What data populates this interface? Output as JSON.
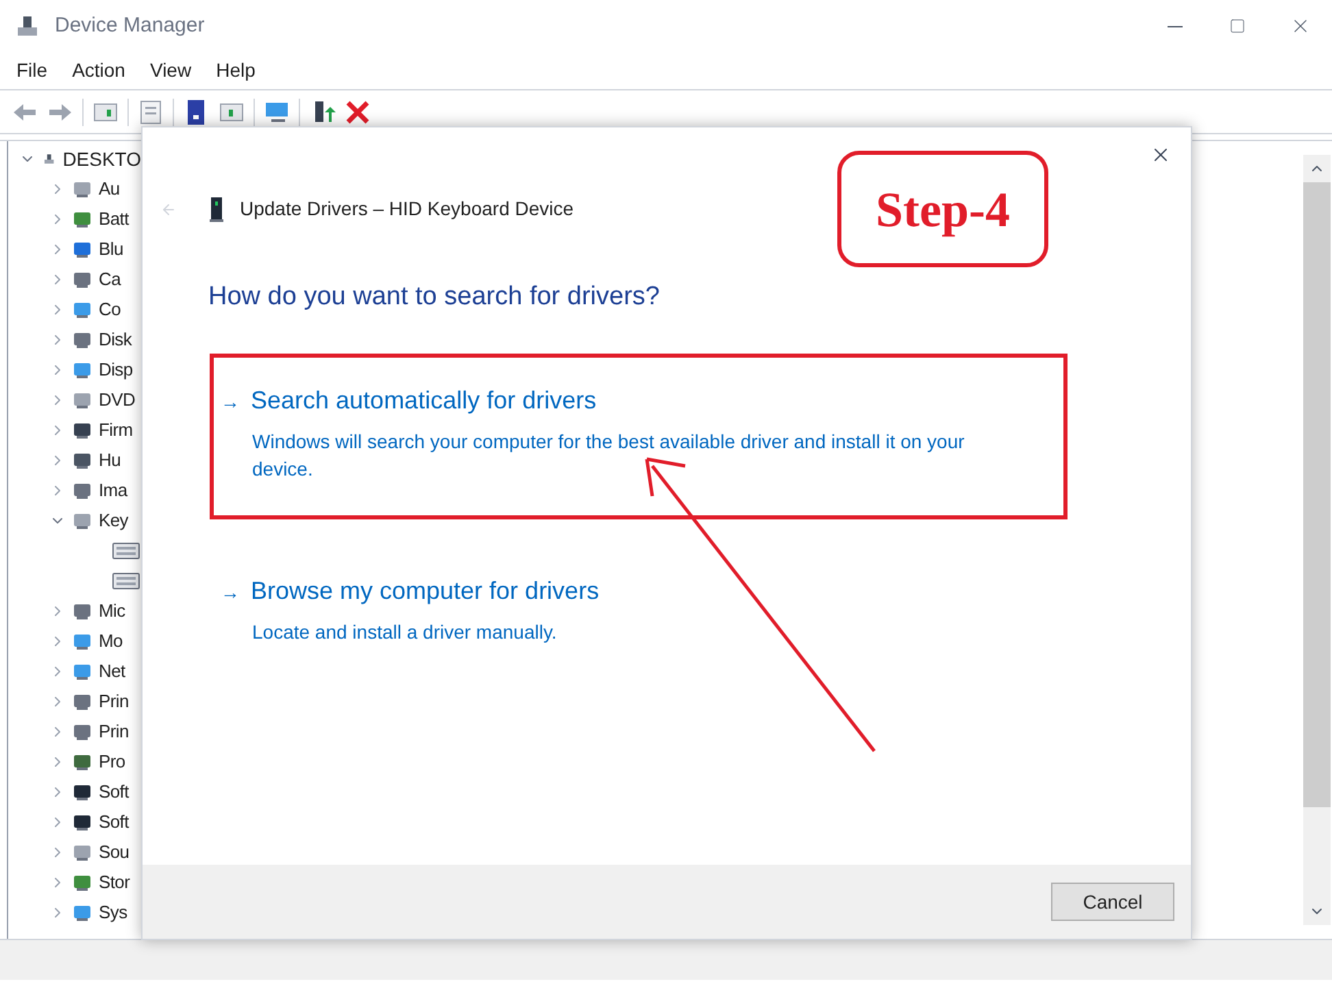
{
  "window": {
    "title": "Device Manager"
  },
  "menu": [
    "File",
    "Action",
    "View",
    "Help"
  ],
  "tree": {
    "label": "DESKTO",
    "expanded": true,
    "children": [
      {
        "label": "Au",
        "expanded": false
      },
      {
        "label": "Batt",
        "expanded": false
      },
      {
        "label": "Blu",
        "expanded": false
      },
      {
        "label": "Ca",
        "expanded": false
      },
      {
        "label": "Co",
        "expanded": false
      },
      {
        "label": "Disk",
        "expanded": false
      },
      {
        "label": "Disp",
        "expanded": false
      },
      {
        "label": "DVD",
        "expanded": false
      },
      {
        "label": "Firm",
        "expanded": false
      },
      {
        "label": "Hu",
        "expanded": false
      },
      {
        "label": "Ima",
        "expanded": false
      },
      {
        "label": "Key",
        "expanded": true,
        "children": [
          {
            "kind": "leaf"
          },
          {
            "kind": "leaf"
          }
        ]
      },
      {
        "label": "Mic",
        "expanded": false
      },
      {
        "label": "Mo",
        "expanded": false
      },
      {
        "label": "Net",
        "expanded": false
      },
      {
        "label": "Prin",
        "expanded": false
      },
      {
        "label": "Prin",
        "expanded": false
      },
      {
        "label": "Pro",
        "expanded": false
      },
      {
        "label": "Soft",
        "expanded": false
      },
      {
        "label": "Soft",
        "expanded": false
      },
      {
        "label": "Sou",
        "expanded": false
      },
      {
        "label": "Stor",
        "expanded": false
      },
      {
        "label": "Sys",
        "expanded": false
      }
    ]
  },
  "dialog": {
    "title": "Update Drivers – HID Keyboard Device",
    "heading": "How do you want to search for drivers?",
    "options": [
      {
        "title": "Search automatically for drivers",
        "description": "Windows will search your computer for the best available driver and install it on your device.",
        "highlighted": true
      },
      {
        "title": "Browse my computer for drivers",
        "description": "Locate and install a driver manually.",
        "highlighted": false
      }
    ],
    "arrow": "→",
    "buttons": [
      "Cancel"
    ]
  },
  "annotation": {
    "label": "Step-4"
  }
}
